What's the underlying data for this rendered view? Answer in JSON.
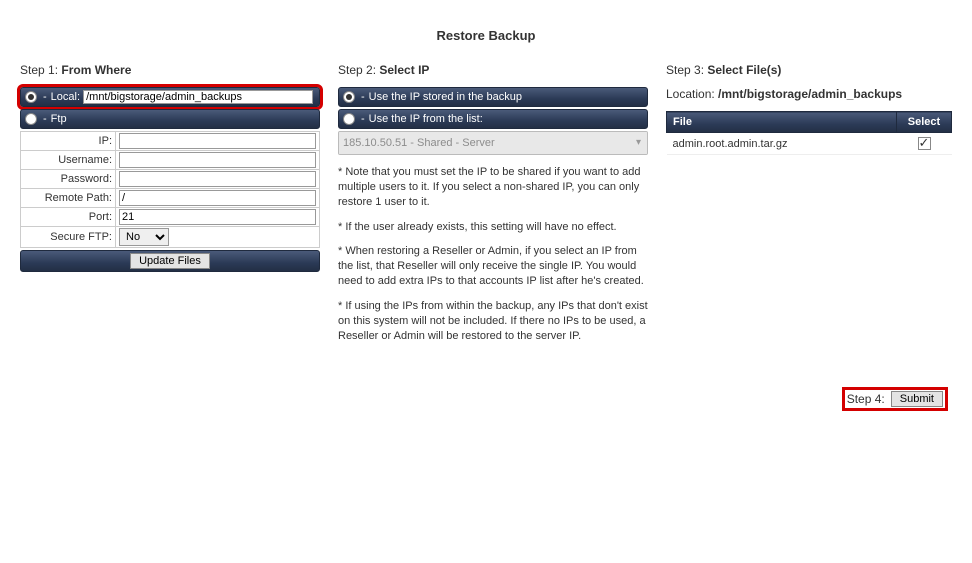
{
  "title": "Restore Backup",
  "steps": {
    "s1_prefix": "Step 1: ",
    "s1_bold": "From Where",
    "s2_prefix": "Step 2: ",
    "s2_bold": "Select IP",
    "s3_prefix": "Step 3: ",
    "s3_bold": "Select File(s)",
    "s4_label": "Step 4:"
  },
  "step1": {
    "local_label": "Local:",
    "local_value": "/mnt/bigstorage/admin_backups",
    "ftp_label": "Ftp",
    "fields": {
      "ip": "IP:",
      "username": "Username:",
      "password": "Password:",
      "remote_path": "Remote Path:",
      "remote_path_value": "/",
      "port": "Port:",
      "port_value": "21",
      "secure_ftp": "Secure FTP:",
      "secure_ftp_value": "No"
    },
    "update_button": "Update Files"
  },
  "step2": {
    "opt_stored": "Use the IP stored in the backup",
    "opt_list": "Use the IP from the list:",
    "ip_dropdown": "185.10.50.51 - Shared - Server",
    "note1": "* Note that you must set the IP to be shared if you want to add multiple users to it. If you select a non-shared IP, you can only restore 1 user to it.",
    "note2": "* If the user already exists, this setting will have no effect.",
    "note3": "* When restoring a Reseller or Admin, if you select an IP from the list, that Reseller will only receive the single IP. You would need to add extra IPs to that accounts IP list after he's created.",
    "note4": "* If using the IPs from within the backup, any IPs that don't exist on this system will not be included. If there no IPs to be used, a Reseller or Admin will be restored to the server IP."
  },
  "step3": {
    "location_label": "Location: ",
    "location_value": "/mnt/bigstorage/admin_backups",
    "th_file": "File",
    "th_select": "Select",
    "rows": [
      {
        "file": "admin.root.admin.tar.gz",
        "checked": true
      }
    ]
  },
  "submit_label": "Submit"
}
